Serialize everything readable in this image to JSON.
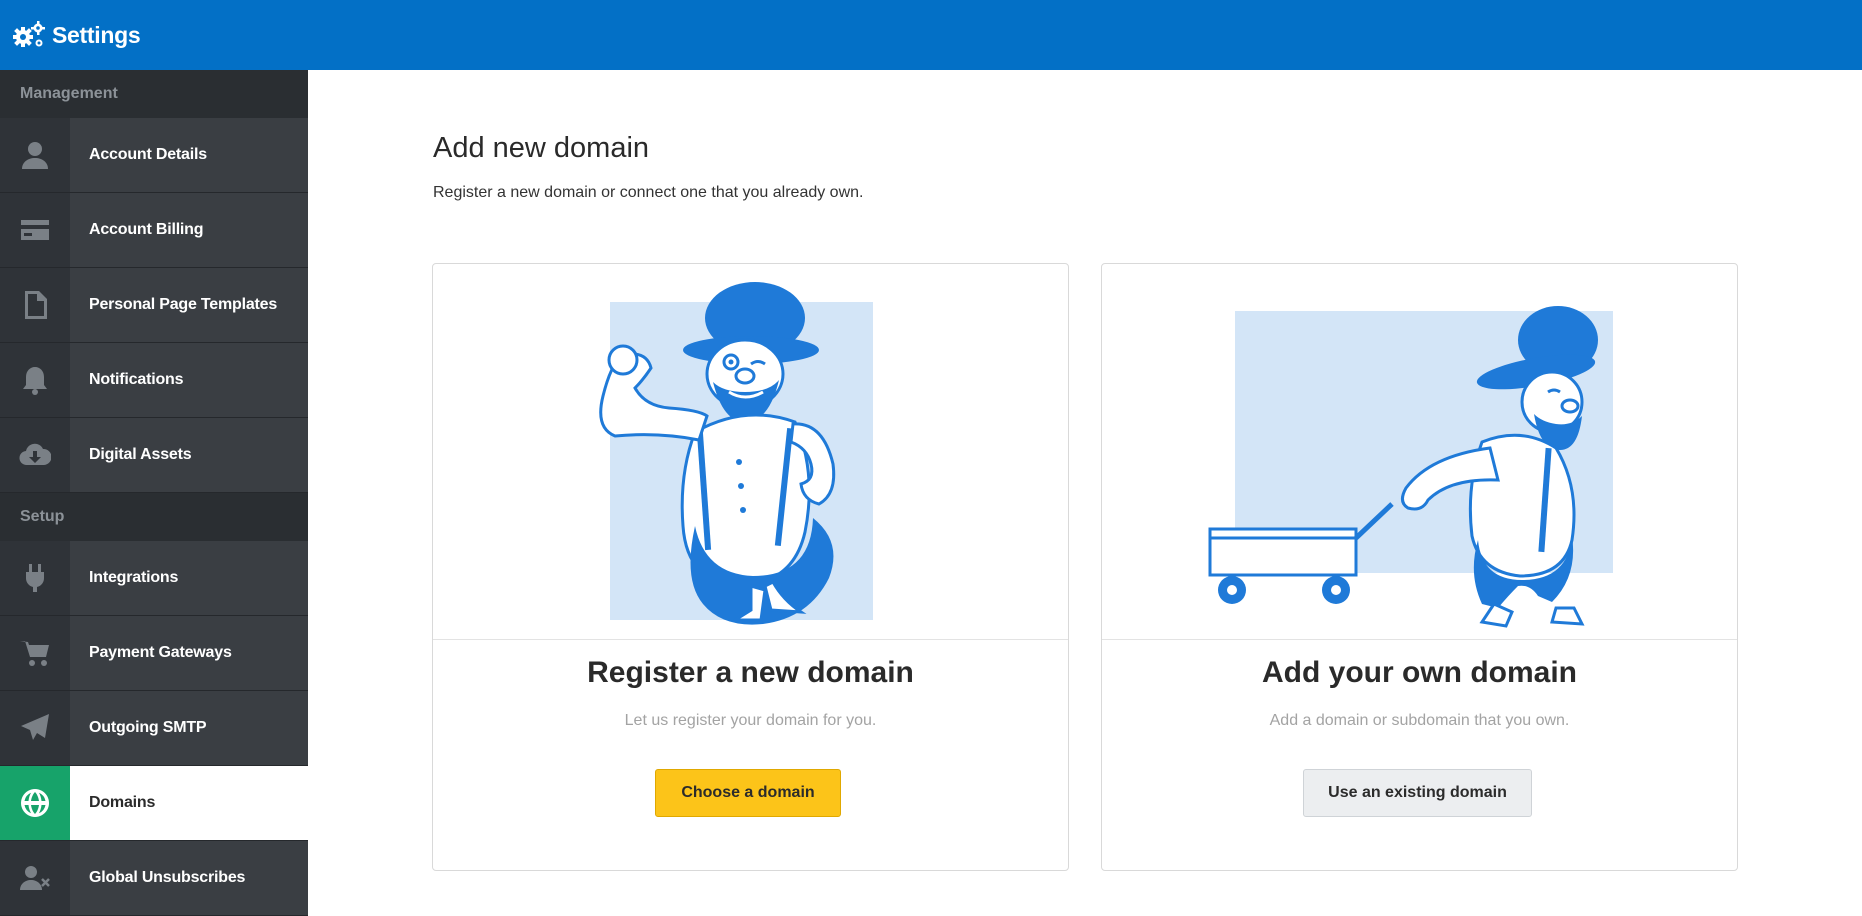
{
  "header": {
    "title": "Settings",
    "icon": "gears-icon"
  },
  "sidebar": {
    "sections": [
      {
        "title": "Management",
        "items": [
          {
            "label": "Account Details",
            "icon": "user-icon",
            "active": false
          },
          {
            "label": "Account Billing",
            "icon": "credit-card-icon",
            "active": false
          },
          {
            "label": "Personal Page Templates",
            "icon": "file-icon",
            "active": false
          },
          {
            "label": "Notifications",
            "icon": "bell-icon",
            "active": false
          },
          {
            "label": "Digital Assets",
            "icon": "cloud-download-icon",
            "active": false
          }
        ]
      },
      {
        "title": "Setup",
        "items": [
          {
            "label": "Integrations",
            "icon": "plug-icon",
            "active": false
          },
          {
            "label": "Payment Gateways",
            "icon": "cart-icon",
            "active": false
          },
          {
            "label": "Outgoing SMTP",
            "icon": "paper-plane-icon",
            "active": false
          },
          {
            "label": "Domains",
            "icon": "globe-icon",
            "active": true
          },
          {
            "label": "Global Unsubscribes",
            "icon": "user-x-icon",
            "active": false
          }
        ]
      }
    ]
  },
  "main": {
    "title": "Add new domain",
    "subtitle": "Register a new domain or connect one that you already own.",
    "cards": [
      {
        "heading": "Register a new domain",
        "description": "Let us register your domain for you.",
        "button": "Choose a domain"
      },
      {
        "heading": "Add your own domain",
        "description": "Add a domain or subdomain that you own.",
        "button": "Use an existing domain"
      }
    ]
  },
  "colors": {
    "header": "#0370c6",
    "sidebar": "#3a3e43",
    "active_icon_bg": "#17a36a",
    "primary_button": "#fcc419",
    "illustration_blue": "#1f7ad8",
    "illustration_bg": "#d3e5f7"
  }
}
